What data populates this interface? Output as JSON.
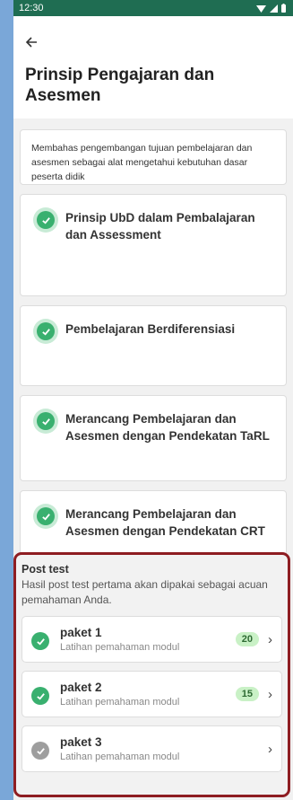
{
  "status": {
    "time": "12:30"
  },
  "header": {
    "title": "Prinsip Pengajaran dan Asesmen"
  },
  "description": "Membahas pengembangan tujuan pembelajaran dan asesmen sebagai alat mengetahui kebutuhan dasar peserta didik",
  "topics": [
    {
      "title": "Prinsip UbD dalam Pembalajaran dan Assessment",
      "status": "completed"
    },
    {
      "title": "Pembelajaran Berdiferensiasi",
      "status": "completed"
    },
    {
      "title": "Merancang Pembelajaran dan Asesmen dengan Pendekatan TaRL",
      "status": "completed"
    },
    {
      "title": "Merancang Pembelajaran dan Asesmen dengan Pendekatan CRT",
      "status": "completed"
    }
  ],
  "post_test": {
    "title": "Post test",
    "subtitle": "Hasil post test pertama akan dipakai sebagai acuan pemahaman Anda.",
    "packages": [
      {
        "name": "paket 1",
        "subtitle": "Latihan pemahaman modul",
        "score": "20",
        "status": "completed"
      },
      {
        "name": "paket 2",
        "subtitle": "Latihan pemahaman modul",
        "score": "15",
        "status": "completed"
      },
      {
        "name": "paket 3",
        "subtitle": "Latihan pemahaman modul",
        "status": "not-completed"
      }
    ]
  },
  "colors": {
    "accent": "#39b06f",
    "status_bar": "#1f6d52",
    "highlight_border": "#8e1d22",
    "badge_bg": "#c9f1c6"
  }
}
